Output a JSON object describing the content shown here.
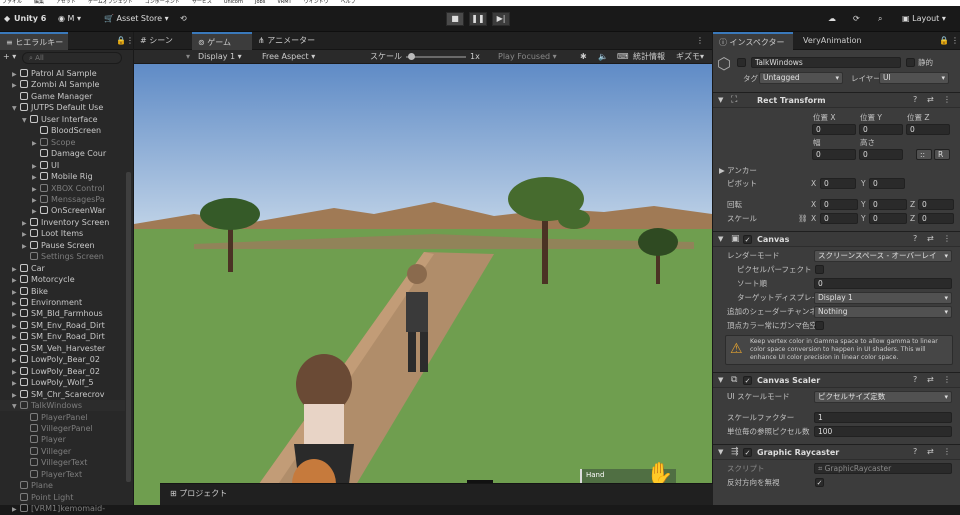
{
  "menubar": [
    "ファイル",
    "編集",
    "アセット",
    "ゲームオブジェクト",
    "コンポーネント",
    "サービス",
    "Unicorn",
    "Jobs",
    "VRMT",
    "ウインドウ",
    "ヘルプ"
  ],
  "toolbar": {
    "app": "Unity 6",
    "account": "M",
    "asset_store": "Asset Store",
    "layout": "Layout"
  },
  "hierarchy": {
    "tab": "ヒエラルキー",
    "search_placeholder": "All",
    "rows": [
      {
        "label": "Patrol AI Sample",
        "indent": 1,
        "arrow": "▶",
        "dim": false
      },
      {
        "label": "Zombi AI Sample",
        "indent": 1,
        "arrow": "▶",
        "dim": false
      },
      {
        "label": "Game Manager",
        "indent": 1,
        "arrow": "",
        "dim": false
      },
      {
        "label": "JUTPS Default Use",
        "indent": 1,
        "arrow": "▼",
        "dim": false
      },
      {
        "label": "User Interface",
        "indent": 2,
        "arrow": "▼",
        "dim": false
      },
      {
        "label": "BloodScreen",
        "indent": 3,
        "arrow": "",
        "dim": false
      },
      {
        "label": "Scope",
        "indent": 3,
        "arrow": "▶",
        "dim": true
      },
      {
        "label": "Damage Cour",
        "indent": 3,
        "arrow": "",
        "dim": false
      },
      {
        "label": "UI",
        "indent": 3,
        "arrow": "▶",
        "dim": false
      },
      {
        "label": "Mobile Rig",
        "indent": 3,
        "arrow": "▶",
        "dim": false
      },
      {
        "label": "XBOX Control",
        "indent": 3,
        "arrow": "▶",
        "dim": true
      },
      {
        "label": "MenssagesPa",
        "indent": 3,
        "arrow": "▶",
        "dim": true
      },
      {
        "label": "OnScreenWar",
        "indent": 3,
        "arrow": "▶",
        "dim": false
      },
      {
        "label": "Inventory Screen",
        "indent": 2,
        "arrow": "▶",
        "dim": false
      },
      {
        "label": "Loot Items",
        "indent": 2,
        "arrow": "▶",
        "dim": false
      },
      {
        "label": "Pause Screen",
        "indent": 2,
        "arrow": "▶",
        "dim": false
      },
      {
        "label": "Settings Screen",
        "indent": 2,
        "arrow": "",
        "dim": true
      },
      {
        "label": "Car",
        "indent": 1,
        "arrow": "▶",
        "dim": false
      },
      {
        "label": "Motorcycle",
        "indent": 1,
        "arrow": "▶",
        "dim": false
      },
      {
        "label": "Bike",
        "indent": 1,
        "arrow": "▶",
        "dim": false
      },
      {
        "label": "Environment",
        "indent": 1,
        "arrow": "▶",
        "dim": false
      },
      {
        "label": "SM_Bld_Farmhous",
        "indent": 1,
        "arrow": "▶",
        "dim": false
      },
      {
        "label": "SM_Env_Road_Dirt",
        "indent": 1,
        "arrow": "▶",
        "dim": false
      },
      {
        "label": "SM_Env_Road_Dirt",
        "indent": 1,
        "arrow": "▶",
        "dim": false
      },
      {
        "label": "SM_Veh_Harvester",
        "indent": 1,
        "arrow": "▶",
        "dim": false
      },
      {
        "label": "LowPoly_Bear_02",
        "indent": 1,
        "arrow": "▶",
        "dim": false
      },
      {
        "label": "LowPoly_Bear_02",
        "indent": 1,
        "arrow": "▶",
        "dim": false
      },
      {
        "label": "LowPoly_Wolf_5",
        "indent": 1,
        "arrow": "▶",
        "dim": false
      },
      {
        "label": "SM_Chr_Scarecrov",
        "indent": 1,
        "arrow": "▶",
        "dim": false
      },
      {
        "label": "TalkWindows",
        "indent": 1,
        "arrow": "▼",
        "dim": true,
        "sel": true
      },
      {
        "label": "PlayerPanel",
        "indent": 2,
        "arrow": "",
        "dim": true
      },
      {
        "label": "VillegerPanel",
        "indent": 2,
        "arrow": "",
        "dim": true
      },
      {
        "label": "Player",
        "indent": 2,
        "arrow": "",
        "dim": true
      },
      {
        "label": "Villeger",
        "indent": 2,
        "arrow": "",
        "dim": true
      },
      {
        "label": "VillegerText",
        "indent": 2,
        "arrow": "",
        "dim": true
      },
      {
        "label": "PlayerText",
        "indent": 2,
        "arrow": "",
        "dim": true
      },
      {
        "label": "Plane",
        "indent": 1,
        "arrow": "",
        "dim": true
      },
      {
        "label": "Point Light",
        "indent": 1,
        "arrow": "",
        "dim": true
      },
      {
        "label": "[VRM1]kemomaid-",
        "indent": 1,
        "arrow": "▶",
        "dim": true
      }
    ]
  },
  "scene_tabs": {
    "scene": "シーン",
    "game": "ゲーム",
    "animator": "アニメーター"
  },
  "game_controls": {
    "display": "Display 1",
    "aspect": "Free Aspect",
    "scale_label": "スケール",
    "scale_value": "1x",
    "play_focused": "Play Focused",
    "stats": "統計情報",
    "gizmos": "ギズモ"
  },
  "game_view": {
    "hud_label": "Hand",
    "hud_badge": "W"
  },
  "bottom_panel": {
    "project_tab": "プロジェクト"
  },
  "inspector": {
    "tabs": {
      "inspector": "インスペクター",
      "other": "VeryAnimation"
    },
    "object_name": "TalkWindows",
    "static_label": "静的",
    "tag_label": "タグ",
    "tag_value": "Untagged",
    "layer_label": "レイヤー",
    "layer_value": "UI",
    "rect": {
      "title": "Rect Transform",
      "pos_x": "位置 X",
      "pos_y": "位置 Y",
      "pos_z": "位置 Z",
      "px": "0",
      "py": "0",
      "pz": "0",
      "width": "幅",
      "height": "高さ",
      "w": "0",
      "h": "0",
      "anchor": "アンカー",
      "pivot": "ピボット",
      "pivot_x": "0",
      "pivot_y": "0",
      "rotation": "回転",
      "rx": "0",
      "ry": "0",
      "rz": "0",
      "scale": "スケール",
      "sx": "0",
      "sy": "0",
      "sz": "0",
      "r_btn": "R"
    },
    "canvas": {
      "title": "Canvas",
      "render_mode_label": "レンダーモード",
      "render_mode": "スクリーンスペース - オーバーレイ",
      "pixel_perfect": "ピクセルパーフェクト",
      "sort_order_label": "ソート順",
      "sort_order": "0",
      "target_display_label": "ターゲットディスプレイ",
      "target_display": "Display 1",
      "shader_channels_label": "追加のシェーダーチャンネル",
      "shader_channels": "Nothing",
      "gamma_label": "頂点カラー常にガンマ色空",
      "warning": "Keep vertex color in Gamma space to allow gamma to linear color space conversion to happen in UI shaders. This will enhance UI color precision in linear color space."
    },
    "scaler": {
      "title": "Canvas Scaler",
      "ui_scale_label": "UI スケールモード",
      "ui_scale": "ピクセルサイズ定数",
      "scale_factor_label": "スケールファクター",
      "scale_factor": "1",
      "ref_ppu_label": "単位毎の参照ピクセル数",
      "ref_ppu": "100"
    },
    "raycaster": {
      "title": "Graphic Raycaster",
      "script_label": "スクリプト",
      "script": "GraphicRaycaster",
      "reverse_label": "反対方向を無視"
    }
  }
}
